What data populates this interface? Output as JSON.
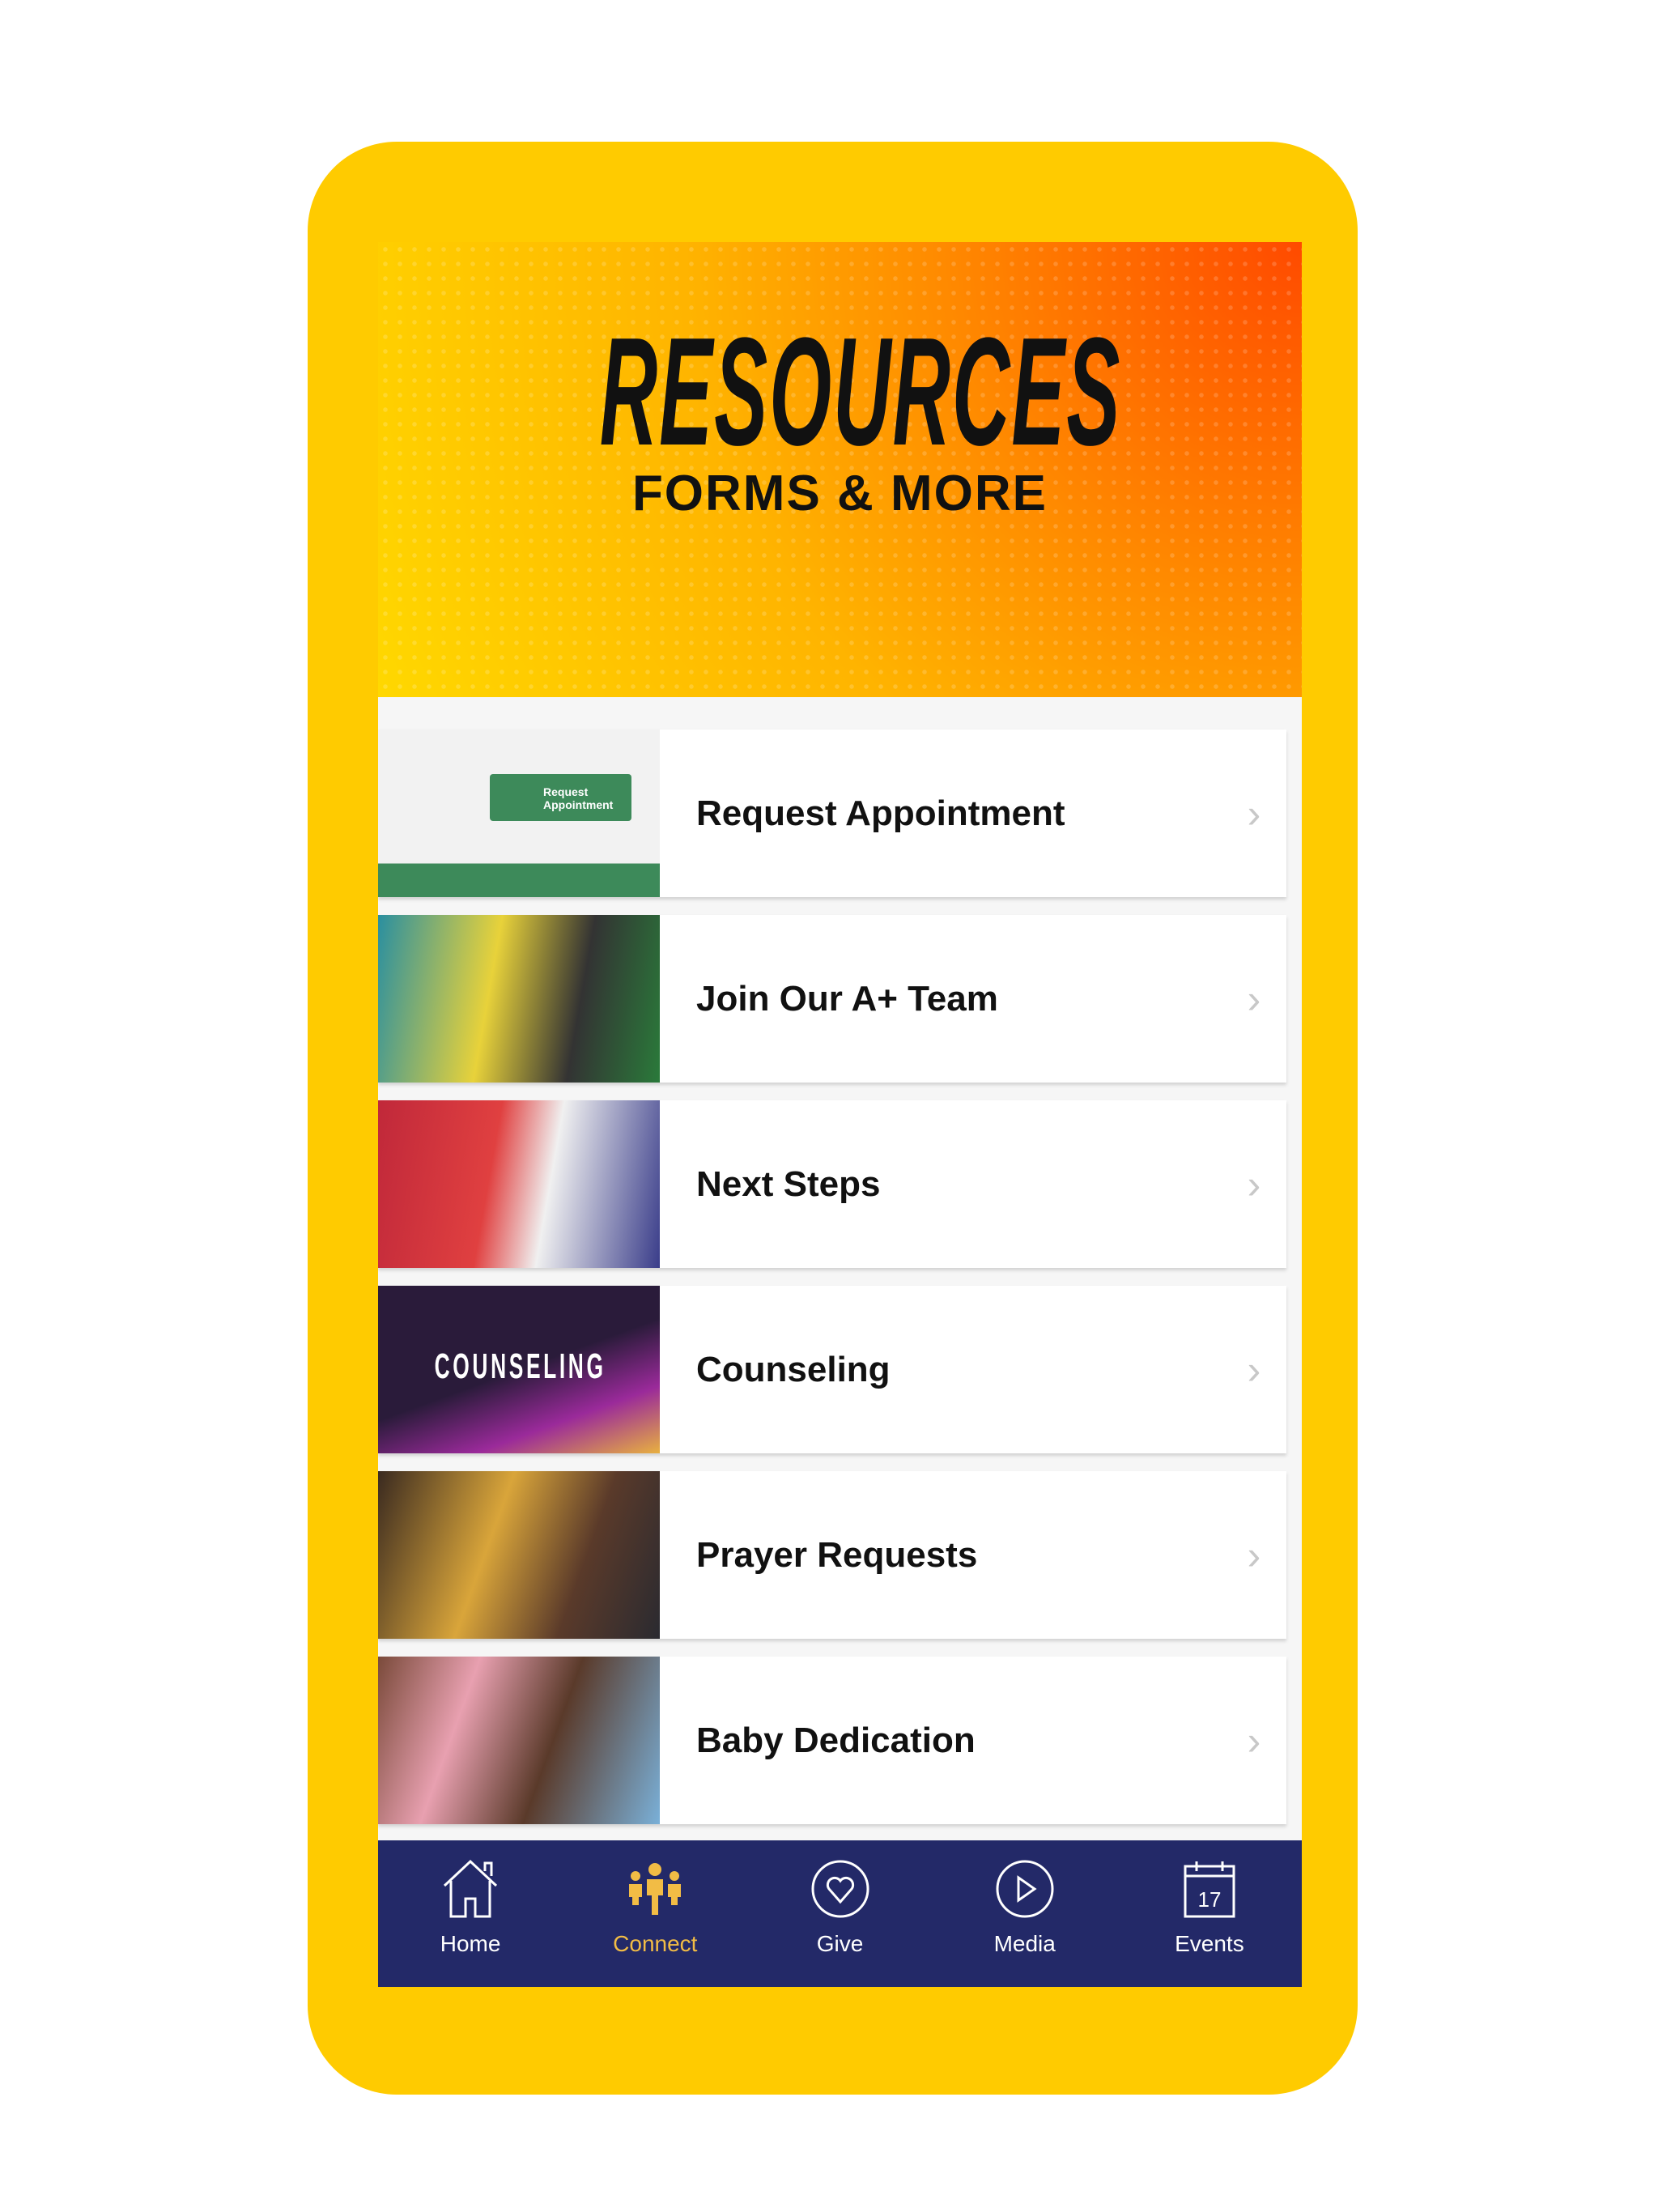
{
  "header": {
    "title": "RESOURCES",
    "subtitle": "FORMS & MORE"
  },
  "items": [
    {
      "label": "Request Appointment",
      "thumb_text": "Request Appointment",
      "thumb_colors": [
        "#f2f2f2",
        "#3d8a5a"
      ]
    },
    {
      "label": "Join Our A+ Team",
      "thumb_colors": [
        "#2a8fa0",
        "#e8d23a"
      ]
    },
    {
      "label": "Next Steps",
      "thumb_colors": [
        "#c0283a",
        "#3a3d8a"
      ]
    },
    {
      "label": "Counseling",
      "thumb_text": "COUNSELING",
      "thumb_colors": [
        "#2a1b3a",
        "#9a2a9a"
      ]
    },
    {
      "label": "Prayer Requests",
      "thumb_colors": [
        "#3a2a20",
        "#d9a53a"
      ]
    },
    {
      "label": "Baby Dedication",
      "thumb_colors": [
        "#7a4a3a",
        "#e8a0b0"
      ]
    }
  ],
  "tabbar": {
    "items": [
      {
        "label": "Home",
        "icon": "home-icon"
      },
      {
        "label": "Connect",
        "icon": "people-icon",
        "active": true
      },
      {
        "label": "Give",
        "icon": "heart-icon"
      },
      {
        "label": "Media",
        "icon": "play-icon"
      },
      {
        "label": "Events",
        "icon": "calendar-icon",
        "badge": "17"
      }
    ]
  },
  "colors": {
    "frame": "#FFCB00",
    "tabbar": "#232968",
    "active": "#F2BC45"
  }
}
